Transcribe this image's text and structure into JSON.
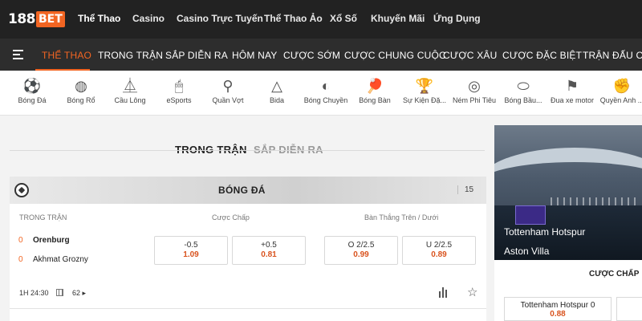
{
  "brand": {
    "num": "188",
    "bet": "BET"
  },
  "topnav": {
    "items": [
      "Thể Thao",
      "Casino",
      "Casino Trực Tuyến",
      "Thể Thao Ảo",
      "Xổ Số",
      "Khuyến Mãi",
      "Ứng Dụng"
    ],
    "active": "Thể Thao"
  },
  "sportbar": {
    "items": [
      "THỂ THAO",
      "TRONG TRẬN",
      "SẮP DIỄN RA",
      "HÔM NAY",
      "CƯỢC SỚM",
      "CƯỢC CHUNG CUỘC",
      "CƯỢC XÂU",
      "CƯỢC ĐẶC BIỆT",
      "TRẬN ĐẤU CỦA"
    ],
    "active": "THỂ THAO"
  },
  "sports": [
    {
      "label": "Bóng Đá",
      "icon": "soccer-ball-icon"
    },
    {
      "label": "Bóng Rổ",
      "icon": "basketball-icon"
    },
    {
      "label": "Cầu Lông",
      "icon": "shuttlecock-icon"
    },
    {
      "label": "eSports",
      "icon": "mouse-icon"
    },
    {
      "label": "Quần Vợt",
      "icon": "tennis-racket-icon"
    },
    {
      "label": "Bida",
      "icon": "billiards-icon"
    },
    {
      "label": "Bóng Chuyền",
      "icon": "volleyball-icon"
    },
    {
      "label": "Bóng Bàn",
      "icon": "table-tennis-icon"
    },
    {
      "label": "Sự Kiện Đặ...",
      "icon": "trophy-icon"
    },
    {
      "label": "Ném Phi Tiêu",
      "icon": "dartboard-icon"
    },
    {
      "label": "Bóng Bầu...",
      "icon": "rugby-ball-icon"
    },
    {
      "label": "Đua xe motor",
      "icon": "checkered-flag-icon"
    },
    {
      "label": "Quyền Anh ...",
      "icon": "boxing-glove-icon"
    }
  ],
  "content_tabs": {
    "active": "TRONG TRẬN",
    "inactive": "SẮP DIỄN RA"
  },
  "section": {
    "title": "BÓNG ĐÁ",
    "count": "15"
  },
  "match": {
    "headers": {
      "status": "TRONG TRẬN",
      "handicap": "Cược Chấp",
      "overunder": "Bàn Thắng Trên / Dưới"
    },
    "home": {
      "score": "0",
      "name": "Orenburg"
    },
    "away": {
      "score": "0",
      "name": "Akhmat Grozny"
    },
    "handicap_home": {
      "line": "-0.5",
      "price": "1.09"
    },
    "handicap_away": {
      "line": "+0.5",
      "price": "0.81"
    },
    "over": {
      "line": "O 2/2.5",
      "price": "0.99"
    },
    "under": {
      "line": "U 2/2.5",
      "price": "0.89"
    },
    "time": "1H 24:30",
    "markets": "62"
  },
  "promo": {
    "team1": "Tottenham Hotspur",
    "team2": "Aston Villa",
    "market_label": "CƯỢC CHẤP",
    "odds_team": "Tottenham Hotspur 0",
    "odds_price": "0.88"
  },
  "colors": {
    "accent": "#f26522",
    "topbar": "#222222",
    "sportbar": "#2d2d2d",
    "odds_price": "#d9531e"
  }
}
